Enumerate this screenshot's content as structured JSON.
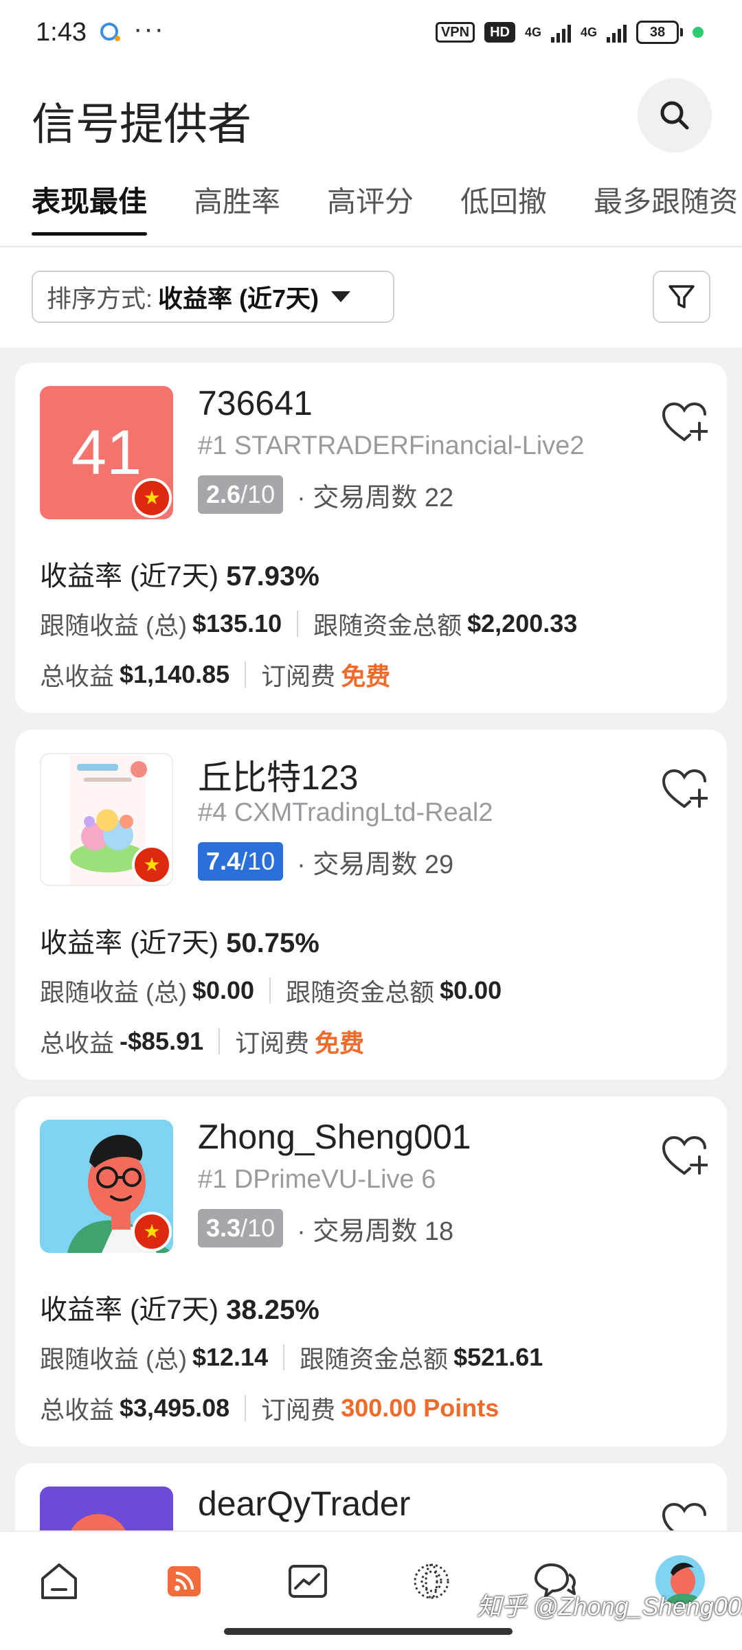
{
  "status_bar": {
    "time": "1:43",
    "dots": "···",
    "badges": [
      "VPN",
      "HD",
      "4G",
      "4G"
    ],
    "battery": "38"
  },
  "header": {
    "title": "信号提供者",
    "tabs": [
      {
        "label": "表现最佳",
        "active": true
      },
      {
        "label": "高胜率"
      },
      {
        "label": "高评分"
      },
      {
        "label": "低回撤"
      },
      {
        "label": "最多跟随资"
      }
    ]
  },
  "sort": {
    "prefix": "排序方式:",
    "value": "收益率 (近7天)"
  },
  "cards": [
    {
      "avatar_text": "41",
      "name": "736641",
      "broker": "#1 STARTRADERFinancial-Live2",
      "rating_score": "2.6",
      "rating_max": "/10",
      "weeks_label": "交易周数 22",
      "return_label": "收益率 (近7天)",
      "return_value": "57.93%",
      "follow_profit_label": "跟随收益 (总)",
      "follow_profit": "$135.10",
      "follow_funds_label": "跟随资金总额",
      "follow_funds": "$2,200.33",
      "total_profit_label": "总收益",
      "total_profit": "$1,140.85",
      "fee_label": "订阅费",
      "fee": "免费"
    },
    {
      "avatar_text": "",
      "name": "丘比特123",
      "broker": "#4 CXMTradingLtd-Real2",
      "rating_score": "7.4",
      "rating_max": "/10",
      "weeks_label": "交易周数 29",
      "return_label": "收益率 (近7天)",
      "return_value": "50.75%",
      "follow_profit_label": "跟随收益 (总)",
      "follow_profit": "$0.00",
      "follow_funds_label": "跟随资金总额",
      "follow_funds": "$0.00",
      "total_profit_label": "总收益",
      "total_profit": "-$85.91",
      "fee_label": "订阅费",
      "fee": "免费"
    },
    {
      "avatar_text": "",
      "name": "Zhong_Sheng001",
      "broker": "#1 DPrimeVU-Live 6",
      "rating_score": "3.3",
      "rating_max": "/10",
      "weeks_label": "交易周数 18",
      "return_label": "收益率 (近7天)",
      "return_value": "38.25%",
      "follow_profit_label": "跟随收益 (总)",
      "follow_profit": "$12.14",
      "follow_funds_label": "跟随资金总额",
      "follow_funds": "$521.61",
      "total_profit_label": "总收益",
      "total_profit": "$3,495.08",
      "fee_label": "订阅费",
      "fee": "300.00 Points"
    },
    {
      "name": "dearQyTrader"
    }
  ],
  "watermark": "知乎 @Zhong_Sheng001",
  "colors": {
    "accent_orange": "#f06a2a",
    "rating_gray": "#a7a7ab",
    "rating_blue": "#2b6fd9",
    "avatar_red": "#f4736c"
  }
}
